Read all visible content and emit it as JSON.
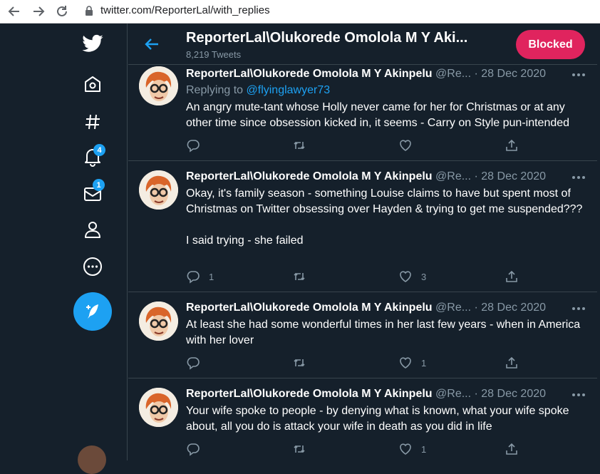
{
  "browser": {
    "url": "twitter.com/ReporterLal/with_replies",
    "back_icon": "arrow-left-icon",
    "forward_icon": "arrow-right-icon",
    "reload_icon": "reload-icon"
  },
  "sidebar": {
    "items": [
      {
        "name": "twitter-logo-icon"
      },
      {
        "name": "home-icon"
      },
      {
        "name": "explore-hashtag-icon"
      },
      {
        "name": "notifications-bell-icon",
        "badge": "4"
      },
      {
        "name": "messages-envelope-icon",
        "badge": "1"
      },
      {
        "name": "profile-person-icon"
      },
      {
        "name": "more-circle-icon"
      }
    ],
    "compose_icon": "compose-tweet-icon"
  },
  "colors": {
    "background": "#15202b",
    "accent": "#1da1f2",
    "blocked": "#e0245e",
    "muted": "#8899a6",
    "border": "#38444d"
  },
  "header": {
    "title": "ReporterLal\\Olukorede Omolola M Y Aki...",
    "subtitle": "8,219 Tweets",
    "blocked_label": "Blocked"
  },
  "tweets": [
    {
      "name": "ReporterLal\\Olukorede Omolola M Y Akinpelu",
      "handle": "@Re...",
      "dot": "·",
      "date": "28 Dec 2020",
      "replying_prefix": "Replying to ",
      "replying_to": "@flyinglawyer73",
      "text": "An angry mute-tant whose Holly never came for her for Christmas or at any other time since obsession kicked in, it seems - Carry on Style pun-intended",
      "replies": "",
      "retweets": "",
      "likes": ""
    },
    {
      "name": "ReporterLal\\Olukorede Omolola M Y Akinpelu",
      "handle": "@Re...",
      "dot": "·",
      "date": "28 Dec 2020",
      "text": "Okay, it's family season - something Louise claims to have but spent most of Christmas on Twitter obsessing over Hayden & trying to get me suspended???\n\nI said trying - she failed",
      "replies": "1",
      "retweets": "",
      "likes": "3"
    },
    {
      "name": "ReporterLal\\Olukorede Omolola M Y Akinpelu",
      "handle": "@Re...",
      "dot": "·",
      "date": "28 Dec 2020",
      "text": "At least she had some wonderful times in her last few years - when in America with her lover",
      "replies": "",
      "retweets": "",
      "likes": "1"
    },
    {
      "name": "ReporterLal\\Olukorede Omolola M Y Akinpelu",
      "handle": "@Re...",
      "dot": "·",
      "date": "28 Dec 2020",
      "text": "Your wife spoke to people - by denying what is known, what your wife spoke about, all you do is attack your wife in death as you did in life",
      "replies": "",
      "retweets": "",
      "likes": "1"
    }
  ]
}
